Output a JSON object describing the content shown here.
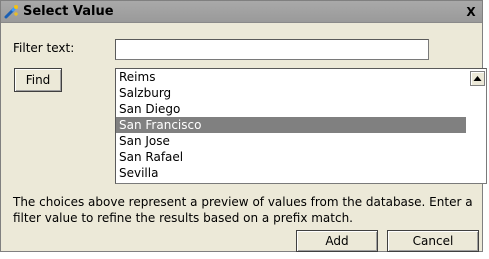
{
  "window": {
    "title": "Select Value",
    "close_symbol": "X"
  },
  "filter": {
    "label": "Filter text:",
    "value": "",
    "placeholder": ""
  },
  "buttons": {
    "find": "Find",
    "add": "Add",
    "cancel": "Cancel"
  },
  "list": {
    "items": [
      "Reims",
      "Salzburg",
      "San Diego",
      "San Francisco",
      "San Jose",
      "San Rafael",
      "Sevilla"
    ],
    "selected": "San Francisco"
  },
  "description": "The choices above represent a preview of values from the database.  Enter a filter value to refine the results based on a prefix match.",
  "colors": {
    "dialog_bg": "#ece9d8",
    "titlebar_bg": "#a0a0a0",
    "selection_bg": "#808080",
    "selection_fg": "#ffffff"
  },
  "icons": {
    "title": "wand-icon",
    "close": "close-icon",
    "scroll": "scroll-up-arrow-icon"
  }
}
